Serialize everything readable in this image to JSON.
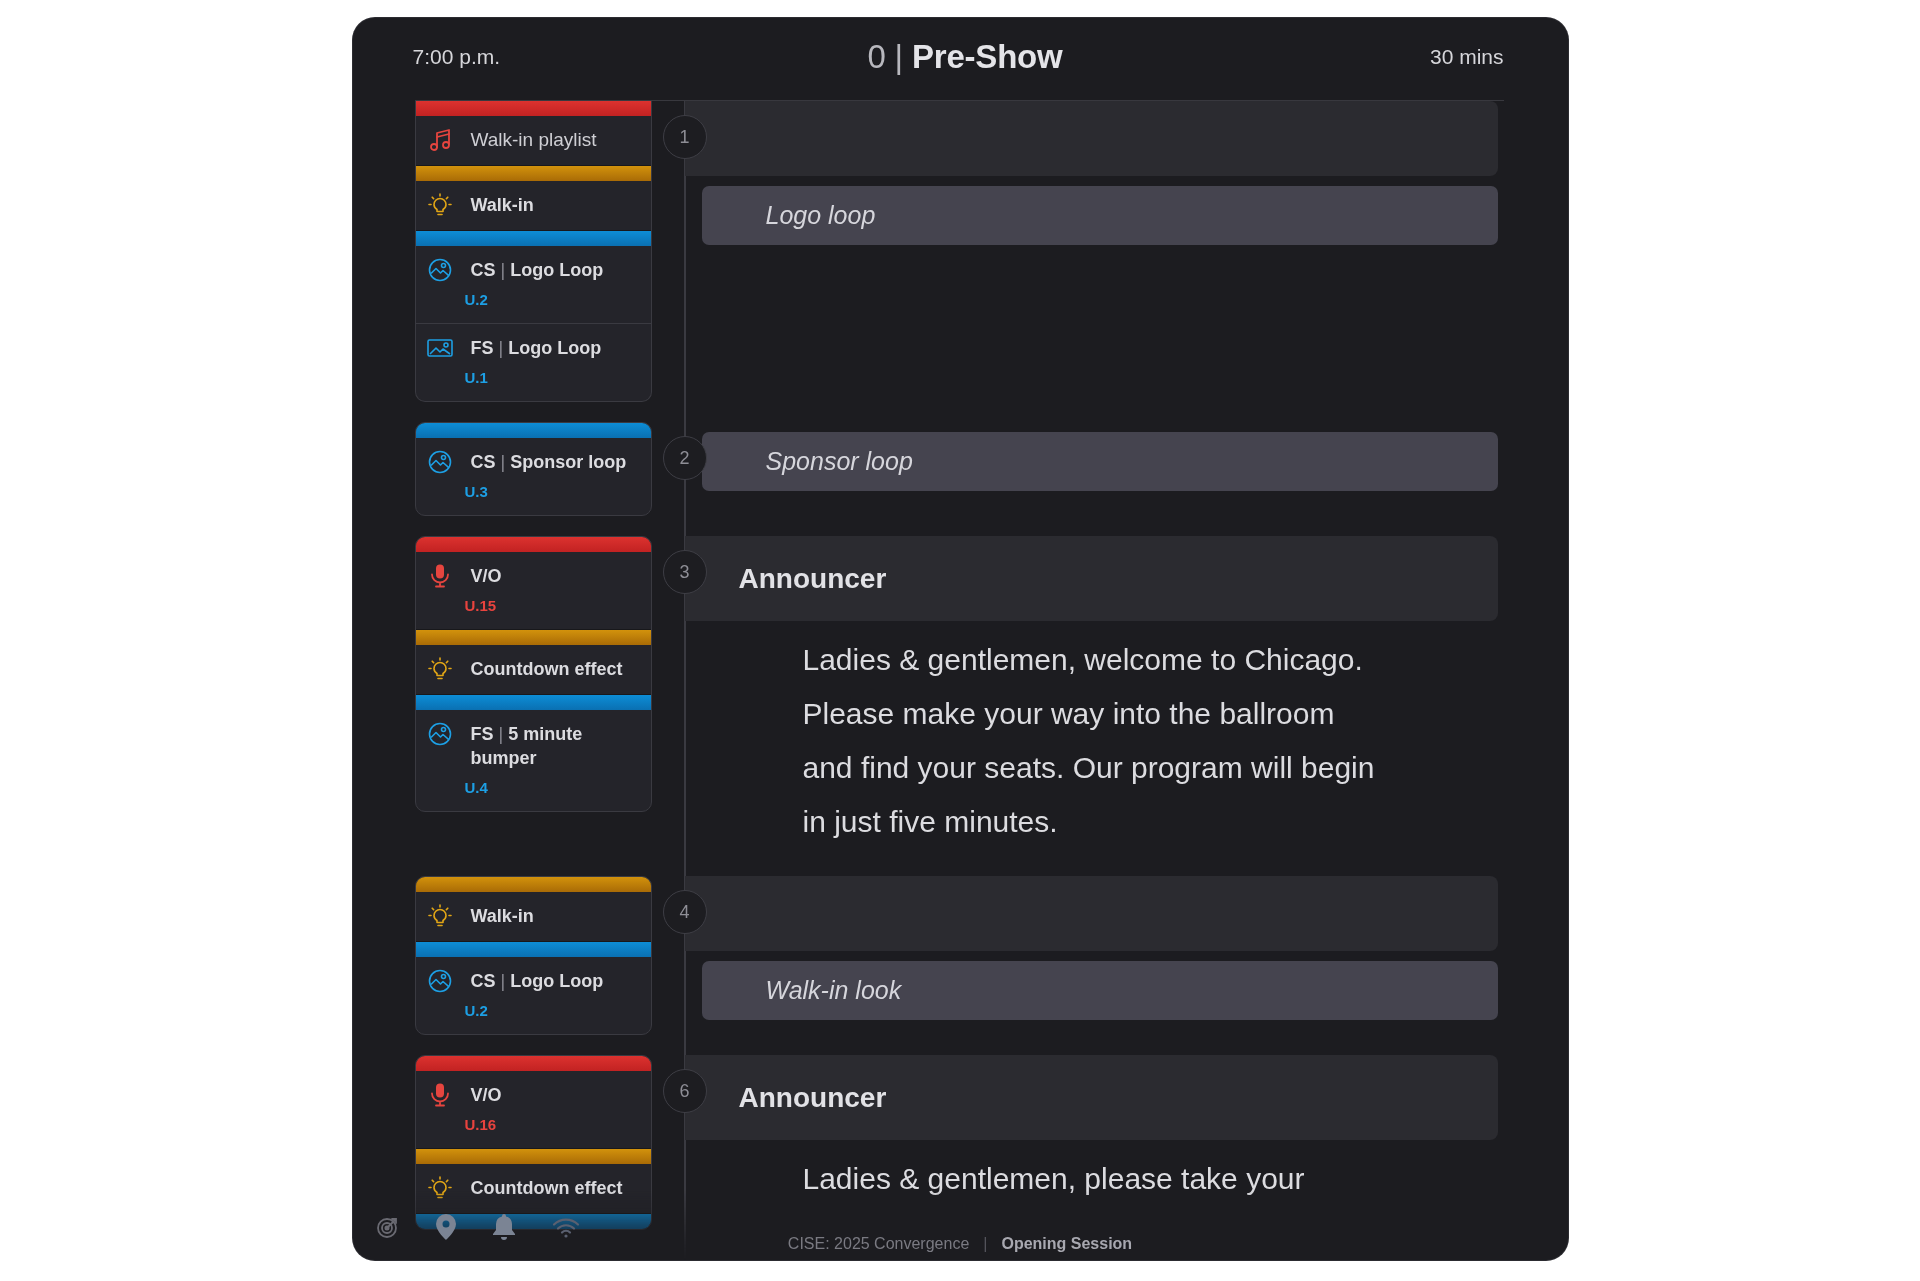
{
  "header": {
    "time": "7:00 p.m.",
    "title": "0 | **Pre-Show**",
    "duration": "30 mins"
  },
  "cues": [
    {
      "number": "1",
      "header_bar": true,
      "stack": [
        {
          "kind": "sound",
          "items": [
            {
              "kind": "music",
              "title": "Walk-in playlist"
            }
          ]
        },
        {
          "kind": "lighting",
          "items": [
            {
              "kind": "light",
              "title": "Walk-in"
            }
          ]
        },
        {
          "kind": "video",
          "items": [
            {
              "kind": "motion",
              "prefix": "CS",
              "separator": "|",
              "title": "Logo Loop",
              "code": "U.2"
            },
            {
              "kind": "still",
              "prefix": "FS",
              "separator": "|",
              "title": "Logo Loop",
              "code": "U.1"
            }
          ]
        }
      ],
      "content": [
        {
          "kind": "note",
          "text": "Logo loop"
        }
      ]
    },
    {
      "number": "2",
      "header_bar": false,
      "stack": [
        {
          "kind": "video",
          "items": [
            {
              "kind": "motion",
              "prefix": "CS",
              "separator": "|",
              "title": "Sponsor loop",
              "code": "U.3"
            }
          ]
        }
      ],
      "content": [
        {
          "kind": "note",
          "text": "Sponsor loop"
        }
      ]
    },
    {
      "number": "3",
      "header_bar": true,
      "heading": "Announcer",
      "stack": [
        {
          "kind": "sound",
          "items": [
            {
              "kind": "voice",
              "title": "V/O",
              "code": "U.15"
            }
          ]
        },
        {
          "kind": "lighting",
          "items": [
            {
              "kind": "light",
              "title": "Countdown effect"
            }
          ]
        },
        {
          "kind": "video",
          "items": [
            {
              "kind": "motion",
              "prefix": "FS",
              "separator": "|",
              "title": "5 minute bumper",
              "code": "U.4"
            }
          ]
        }
      ],
      "content": [
        {
          "kind": "script",
          "text": "Ladies & gentlemen, welcome to Chicago. Please make your way into the ballroom and find your seats. Our program will begin in just five minutes."
        }
      ]
    },
    {
      "number": "4",
      "header_bar": true,
      "stack": [
        {
          "kind": "lighting",
          "items": [
            {
              "kind": "light",
              "title": "Walk-in"
            }
          ]
        },
        {
          "kind": "video",
          "items": [
            {
              "kind": "motion",
              "prefix": "CS",
              "separator": "|",
              "title": "Logo Loop",
              "code": "U.2"
            }
          ]
        }
      ],
      "content": [
        {
          "kind": "note",
          "text": "Walk-in look"
        }
      ]
    },
    {
      "number": "6",
      "header_bar": true,
      "heading": "Announcer",
      "stack": [
        {
          "kind": "sound",
          "items": [
            {
              "kind": "voice",
              "title": "V/O",
              "code": "U.16"
            }
          ]
        },
        {
          "kind": "lighting",
          "items": [
            {
              "kind": "light",
              "title": "Countdown effect"
            }
          ]
        },
        {
          "kind": "video"
        }
      ],
      "content": [
        {
          "kind": "script",
          "text": "Ladies & gentlemen, please take your"
        }
      ]
    }
  ],
  "footer": {
    "event": "CISE: 2025 Convergence",
    "separator": "|",
    "session": "Opening Session"
  }
}
